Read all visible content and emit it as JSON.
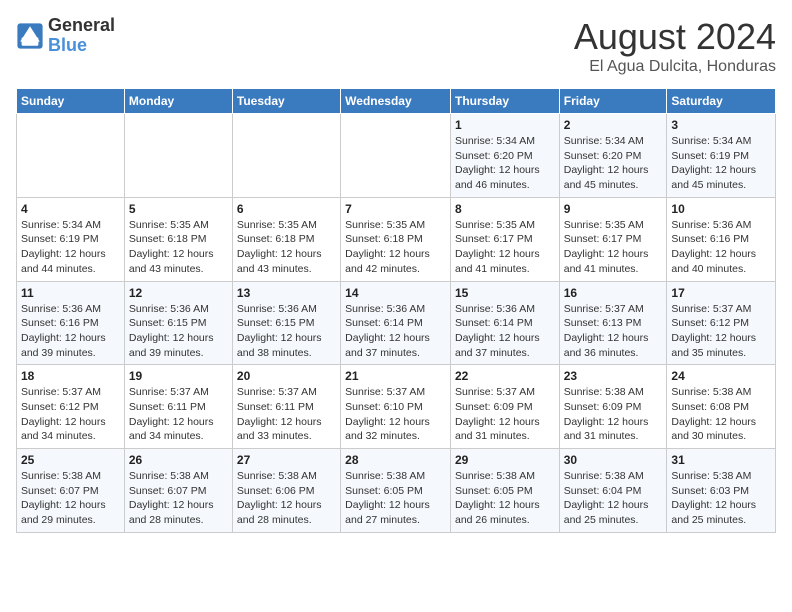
{
  "header": {
    "logo_text_general": "General",
    "logo_text_blue": "Blue",
    "month": "August 2024",
    "location": "El Agua Dulcita, Honduras"
  },
  "weekdays": [
    "Sunday",
    "Monday",
    "Tuesday",
    "Wednesday",
    "Thursday",
    "Friday",
    "Saturday"
  ],
  "weeks": [
    [
      {
        "day": "",
        "info": ""
      },
      {
        "day": "",
        "info": ""
      },
      {
        "day": "",
        "info": ""
      },
      {
        "day": "",
        "info": ""
      },
      {
        "day": "1",
        "info": "Sunrise: 5:34 AM\nSunset: 6:20 PM\nDaylight: 12 hours\nand 46 minutes."
      },
      {
        "day": "2",
        "info": "Sunrise: 5:34 AM\nSunset: 6:20 PM\nDaylight: 12 hours\nand 45 minutes."
      },
      {
        "day": "3",
        "info": "Sunrise: 5:34 AM\nSunset: 6:19 PM\nDaylight: 12 hours\nand 45 minutes."
      }
    ],
    [
      {
        "day": "4",
        "info": "Sunrise: 5:34 AM\nSunset: 6:19 PM\nDaylight: 12 hours\nand 44 minutes."
      },
      {
        "day": "5",
        "info": "Sunrise: 5:35 AM\nSunset: 6:18 PM\nDaylight: 12 hours\nand 43 minutes."
      },
      {
        "day": "6",
        "info": "Sunrise: 5:35 AM\nSunset: 6:18 PM\nDaylight: 12 hours\nand 43 minutes."
      },
      {
        "day": "7",
        "info": "Sunrise: 5:35 AM\nSunset: 6:18 PM\nDaylight: 12 hours\nand 42 minutes."
      },
      {
        "day": "8",
        "info": "Sunrise: 5:35 AM\nSunset: 6:17 PM\nDaylight: 12 hours\nand 41 minutes."
      },
      {
        "day": "9",
        "info": "Sunrise: 5:35 AM\nSunset: 6:17 PM\nDaylight: 12 hours\nand 41 minutes."
      },
      {
        "day": "10",
        "info": "Sunrise: 5:36 AM\nSunset: 6:16 PM\nDaylight: 12 hours\nand 40 minutes."
      }
    ],
    [
      {
        "day": "11",
        "info": "Sunrise: 5:36 AM\nSunset: 6:16 PM\nDaylight: 12 hours\nand 39 minutes."
      },
      {
        "day": "12",
        "info": "Sunrise: 5:36 AM\nSunset: 6:15 PM\nDaylight: 12 hours\nand 39 minutes."
      },
      {
        "day": "13",
        "info": "Sunrise: 5:36 AM\nSunset: 6:15 PM\nDaylight: 12 hours\nand 38 minutes."
      },
      {
        "day": "14",
        "info": "Sunrise: 5:36 AM\nSunset: 6:14 PM\nDaylight: 12 hours\nand 37 minutes."
      },
      {
        "day": "15",
        "info": "Sunrise: 5:36 AM\nSunset: 6:14 PM\nDaylight: 12 hours\nand 37 minutes."
      },
      {
        "day": "16",
        "info": "Sunrise: 5:37 AM\nSunset: 6:13 PM\nDaylight: 12 hours\nand 36 minutes."
      },
      {
        "day": "17",
        "info": "Sunrise: 5:37 AM\nSunset: 6:12 PM\nDaylight: 12 hours\nand 35 minutes."
      }
    ],
    [
      {
        "day": "18",
        "info": "Sunrise: 5:37 AM\nSunset: 6:12 PM\nDaylight: 12 hours\nand 34 minutes."
      },
      {
        "day": "19",
        "info": "Sunrise: 5:37 AM\nSunset: 6:11 PM\nDaylight: 12 hours\nand 34 minutes."
      },
      {
        "day": "20",
        "info": "Sunrise: 5:37 AM\nSunset: 6:11 PM\nDaylight: 12 hours\nand 33 minutes."
      },
      {
        "day": "21",
        "info": "Sunrise: 5:37 AM\nSunset: 6:10 PM\nDaylight: 12 hours\nand 32 minutes."
      },
      {
        "day": "22",
        "info": "Sunrise: 5:37 AM\nSunset: 6:09 PM\nDaylight: 12 hours\nand 31 minutes."
      },
      {
        "day": "23",
        "info": "Sunrise: 5:38 AM\nSunset: 6:09 PM\nDaylight: 12 hours\nand 31 minutes."
      },
      {
        "day": "24",
        "info": "Sunrise: 5:38 AM\nSunset: 6:08 PM\nDaylight: 12 hours\nand 30 minutes."
      }
    ],
    [
      {
        "day": "25",
        "info": "Sunrise: 5:38 AM\nSunset: 6:07 PM\nDaylight: 12 hours\nand 29 minutes."
      },
      {
        "day": "26",
        "info": "Sunrise: 5:38 AM\nSunset: 6:07 PM\nDaylight: 12 hours\nand 28 minutes."
      },
      {
        "day": "27",
        "info": "Sunrise: 5:38 AM\nSunset: 6:06 PM\nDaylight: 12 hours\nand 28 minutes."
      },
      {
        "day": "28",
        "info": "Sunrise: 5:38 AM\nSunset: 6:05 PM\nDaylight: 12 hours\nand 27 minutes."
      },
      {
        "day": "29",
        "info": "Sunrise: 5:38 AM\nSunset: 6:05 PM\nDaylight: 12 hours\nand 26 minutes."
      },
      {
        "day": "30",
        "info": "Sunrise: 5:38 AM\nSunset: 6:04 PM\nDaylight: 12 hours\nand 25 minutes."
      },
      {
        "day": "31",
        "info": "Sunrise: 5:38 AM\nSunset: 6:03 PM\nDaylight: 12 hours\nand 25 minutes."
      }
    ]
  ]
}
